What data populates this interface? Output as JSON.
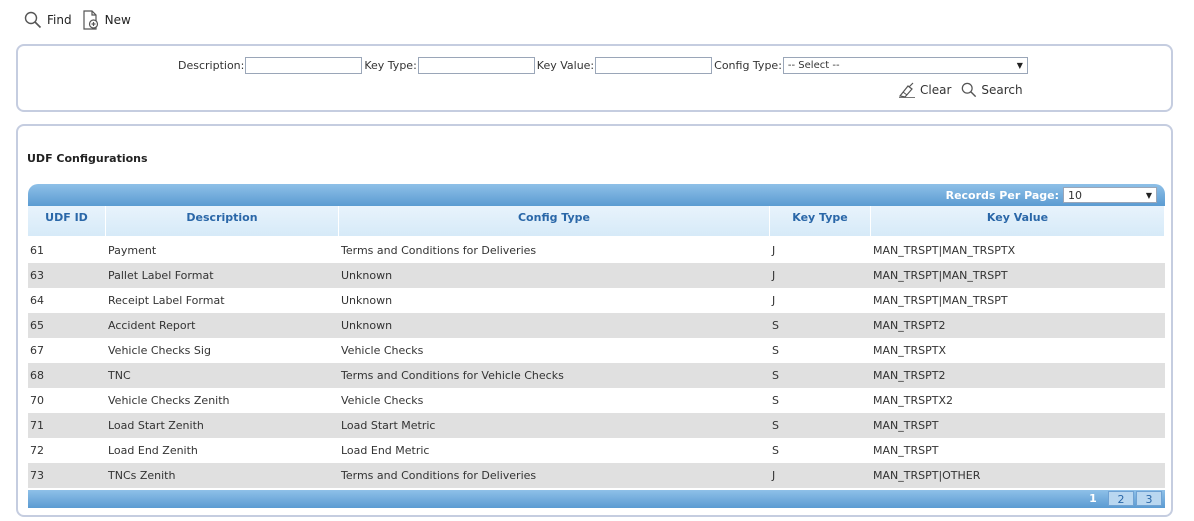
{
  "toolbar": {
    "find_label": "Find",
    "new_label": "New"
  },
  "filters": {
    "description_label": "Description:",
    "description_value": "",
    "key_type_label": "Key Type:",
    "key_type_value": "",
    "key_value_label": "Key Value:",
    "key_value_value": "",
    "config_type_label": "Config Type:",
    "config_type_selected": "-- Select --",
    "clear_label": "Clear",
    "search_label": "Search"
  },
  "grid": {
    "title": "UDF Configurations",
    "records_per_page_label": "Records Per Page:",
    "records_per_page_value": "10",
    "columns": [
      "UDF ID",
      "Description",
      "Config Type",
      "Key Type",
      "Key Value"
    ],
    "rows": [
      [
        "61",
        "Payment",
        "Terms and Conditions for Deliveries",
        "J",
        "MAN_TRSPT|MAN_TRSPTX"
      ],
      [
        "63",
        "Pallet Label Format",
        "Unknown",
        "J",
        "MAN_TRSPT|MAN_TRSPT"
      ],
      [
        "64",
        "Receipt Label Format",
        "Unknown",
        "J",
        "MAN_TRSPT|MAN_TRSPT"
      ],
      [
        "65",
        "Accident Report",
        "Unknown",
        "S",
        "MAN_TRSPT2"
      ],
      [
        "67",
        "Vehicle Checks Sig",
        "Vehicle Checks",
        "S",
        "MAN_TRSPTX"
      ],
      [
        "68",
        "TNC",
        "Terms and Conditions for Vehicle Checks",
        "S",
        "MAN_TRSPT2"
      ],
      [
        "70",
        "Vehicle Checks Zenith",
        "Vehicle Checks",
        "S",
        "MAN_TRSPTX2"
      ],
      [
        "71",
        "Load Start Zenith",
        "Load Start Metric",
        "S",
        "MAN_TRSPT"
      ],
      [
        "72",
        "Load End Zenith",
        "Load End Metric",
        "S",
        "MAN_TRSPT"
      ],
      [
        "73",
        "TNCs Zenith",
        "Terms and Conditions for Deliveries",
        "J",
        "MAN_TRSPT|OTHER"
      ]
    ],
    "pages": [
      "1",
      "2",
      "3"
    ],
    "current_page": "1"
  }
}
